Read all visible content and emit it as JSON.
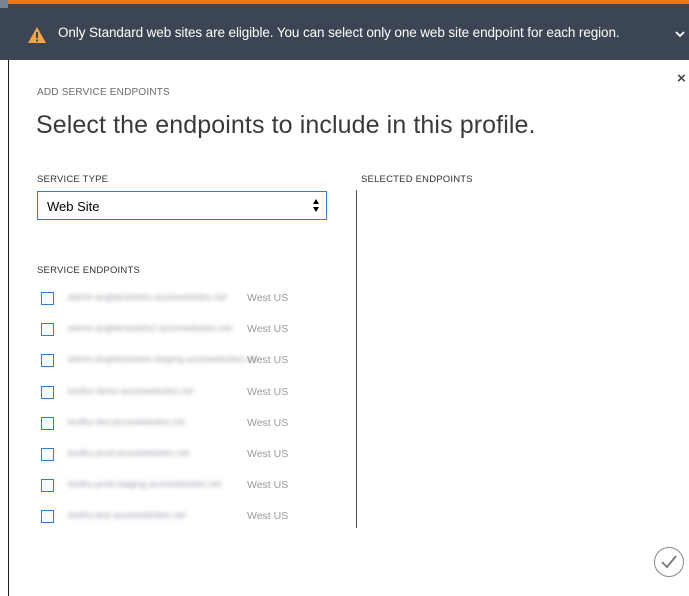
{
  "notification": {
    "icon": "warning-icon",
    "message": "Only Standard web sites are eligible. You can select only one web site endpoint for each region.",
    "accent_color": "#f2a541"
  },
  "dialog": {
    "section_title": "ADD SERVICE ENDPOINTS",
    "heading": "Select the endpoints to include in this profile.",
    "service_type_label": "SERVICE TYPE",
    "service_type_value": "Web Site",
    "service_endpoints_label": "SERVICE ENDPOINTS",
    "selected_endpoints_label": "SELECTED ENDPOINTS",
    "accent_color": "#2b7fd6"
  },
  "endpoints": [
    {
      "name": "admin-anglebrackets.azurewebsites.net",
      "region": "West US",
      "checked": false
    },
    {
      "name": "admin-anglebrackets2.azurewebsites.net",
      "region": "West US",
      "checked": false
    },
    {
      "name": "admin-anglebrackets-staging.azurewebsites.net",
      "region": "West US",
      "checked": false
    },
    {
      "name": "bodhu-demo.azurewebsites.net",
      "region": "West US",
      "checked": false
    },
    {
      "name": "bodhu-dev.azurewebsites.net",
      "region": "West US",
      "checked": false
    },
    {
      "name": "bodhu-prod.azurewebsites.net",
      "region": "West US",
      "checked": false
    },
    {
      "name": "bodhu-prod-staging.azurewebsites.net",
      "region": "West US",
      "checked": false
    },
    {
      "name": "bodhu-test.azurewebsites.net",
      "region": "West US",
      "checked": false
    }
  ]
}
